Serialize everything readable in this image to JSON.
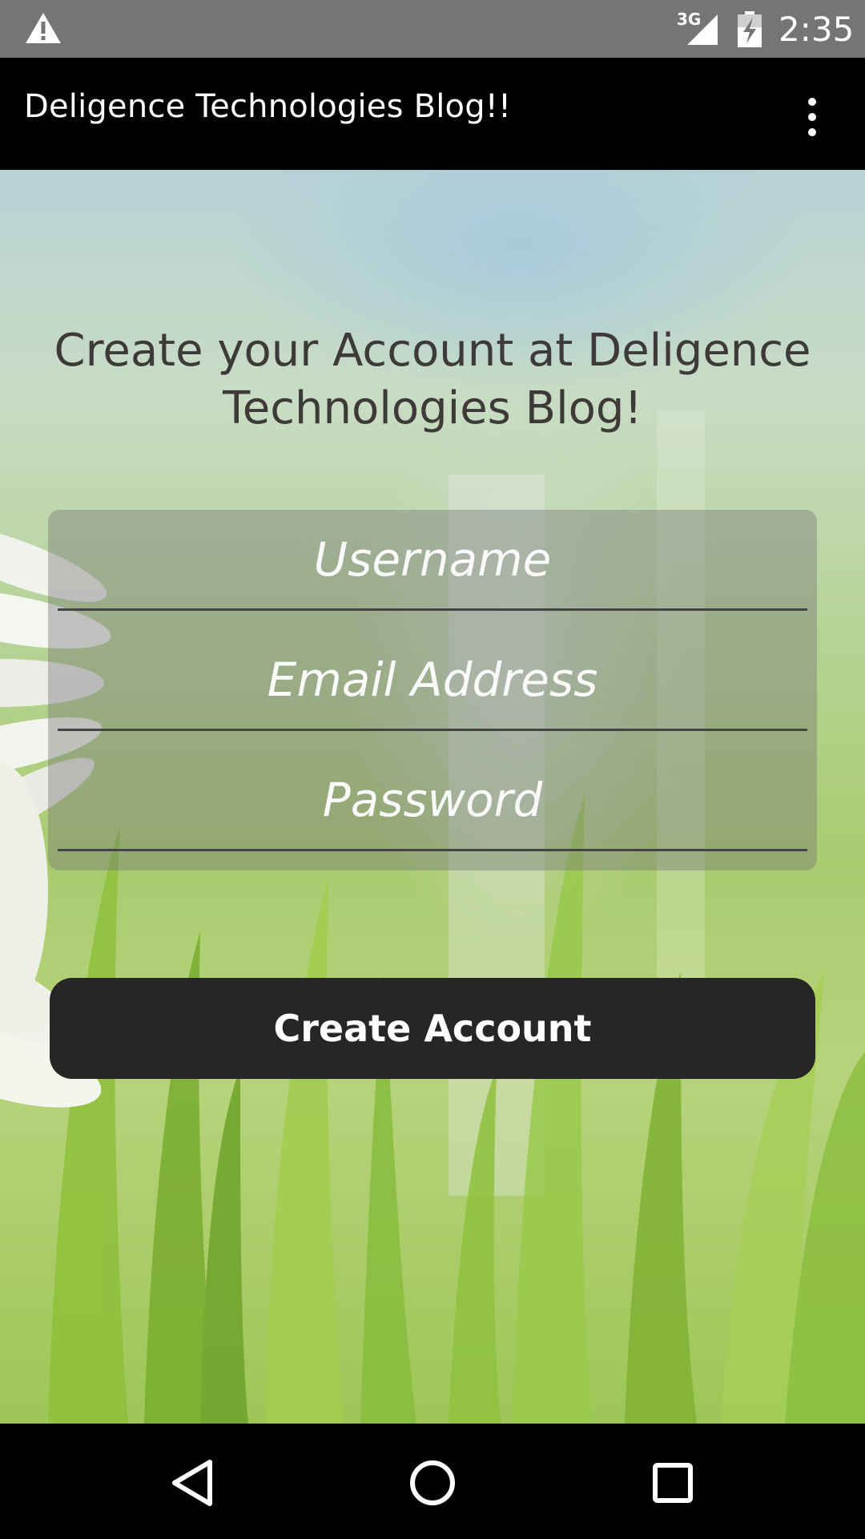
{
  "status_bar": {
    "warning_icon": "warning-triangle-icon",
    "network_type": "3G",
    "signal_icon": "cell-signal-icon",
    "battery_icon": "battery-charging-icon",
    "time": "2:35"
  },
  "action_bar": {
    "title": "Deligence Technologies Blog!!",
    "overflow_icon": "more-vertical-icon"
  },
  "main": {
    "heading": "Create your Account at Deligence Technologies Blog!",
    "form": {
      "username_placeholder": "Username",
      "email_placeholder": "Email Address",
      "password_placeholder": "Password"
    },
    "create_button_label": "Create Account"
  },
  "nav_bar": {
    "back_icon": "back-triangle-icon",
    "home_icon": "home-circle-icon",
    "recents_icon": "recents-square-icon"
  },
  "colors": {
    "status_bar": "#757575",
    "action_bar": "#000000",
    "button": "#282624",
    "heading_text": "#3f3a3a"
  }
}
